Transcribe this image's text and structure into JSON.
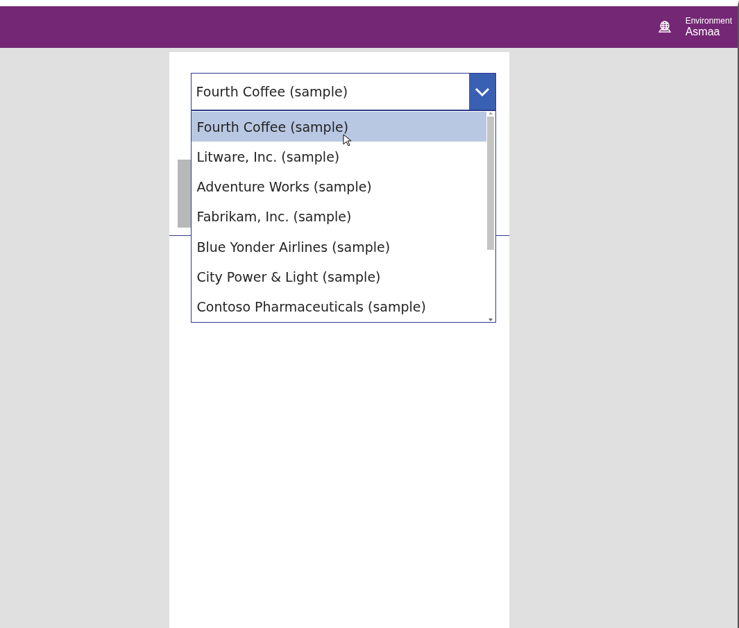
{
  "header": {
    "environment_label": "Environment",
    "environment_name": "Asmaa"
  },
  "dropdown": {
    "value": "Fourth Coffee (sample)",
    "expanded": true,
    "options": [
      {
        "label": "Fourth Coffee (sample)",
        "selected": true
      },
      {
        "label": "Litware, Inc. (sample)",
        "selected": false
      },
      {
        "label": "Adventure Works (sample)",
        "selected": false
      },
      {
        "label": "Fabrikam, Inc. (sample)",
        "selected": false
      },
      {
        "label": "Blue Yonder Airlines (sample)",
        "selected": false
      },
      {
        "label": "City Power & Light (sample)",
        "selected": false
      },
      {
        "label": "Contoso Pharmaceuticals (sample)",
        "selected": false
      }
    ]
  }
}
